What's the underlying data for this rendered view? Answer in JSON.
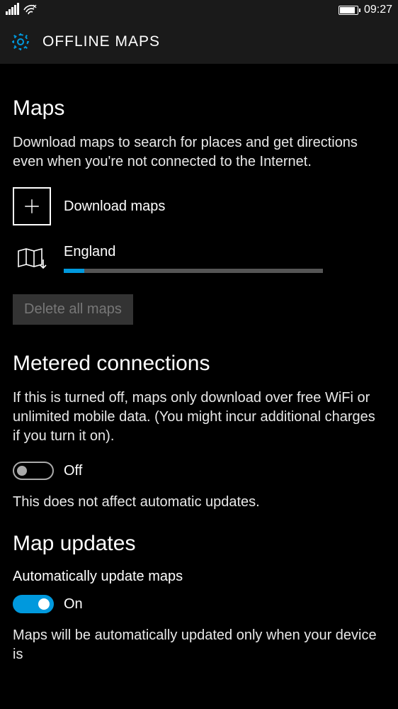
{
  "status": {
    "time": "09:27"
  },
  "header": {
    "title": "OFFLINE MAPS"
  },
  "maps": {
    "heading": "Maps",
    "description": "Download maps to search for places and get directions even when you're not connected to the Internet.",
    "download_label": "Download maps",
    "items": [
      {
        "name": "England",
        "progress_percent": 8
      }
    ],
    "delete_all_label": "Delete all maps"
  },
  "metered": {
    "heading": "Metered connections",
    "description": "If this is turned off, maps only download over free WiFi or unlimited mobile data. (You might incur additional charges if you turn it on).",
    "state_label": "Off",
    "note": "This does not affect automatic updates."
  },
  "updates": {
    "heading": "Map updates",
    "setting_label": "Automatically update maps",
    "state_label": "On",
    "description": "Maps will be automatically updated only when your device is"
  }
}
